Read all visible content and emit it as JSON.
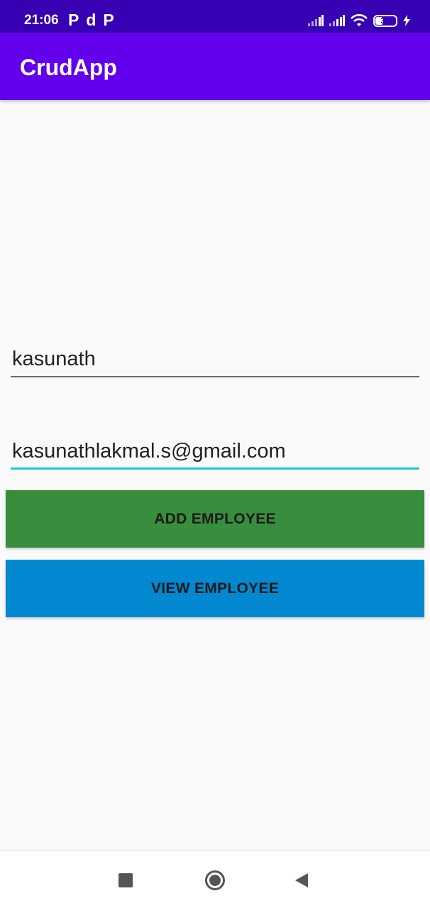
{
  "status_bar": {
    "time": "21:06",
    "notifications": [
      "P",
      "d",
      "P"
    ],
    "battery_level": "37",
    "icons": [
      "signal-icon",
      "signal-icon",
      "wifi-icon",
      "battery-icon",
      "charging-icon"
    ]
  },
  "app_bar": {
    "title": "CrudApp"
  },
  "form": {
    "name_value": "kasunath",
    "email_value": "kasunathlakmal.s@gmail.com"
  },
  "buttons": {
    "add_label": "ADD EMPLOYEE",
    "view_label": "VIEW EMPLOYEE"
  },
  "colors": {
    "status_bar": "#3700b3",
    "app_bar": "#6200ee",
    "add_button": "#388e3c",
    "view_button": "#0288d1",
    "focus_underline": "#1fc6c6"
  },
  "nav_bar": {
    "icons": [
      "recents-icon",
      "home-icon",
      "back-icon"
    ]
  }
}
